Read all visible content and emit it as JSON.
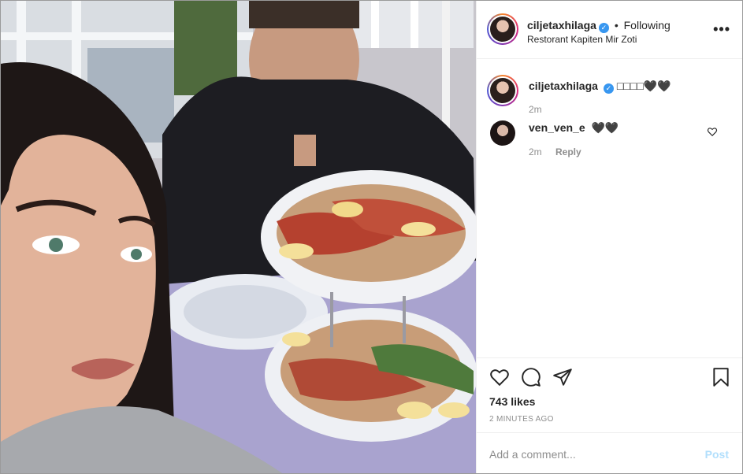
{
  "post": {
    "username": "ciljetaxhilaga",
    "verified_mark": "✓",
    "follow_separator": "•",
    "follow_status": "Following",
    "location": "Restorant Kapiten Mir Zoti",
    "more_label": "•••",
    "photo_icon": "post-photo"
  },
  "comments": [
    {
      "username": "ciljetaxhilaga",
      "text": "□□□□🖤🖤",
      "time": "2m"
    },
    {
      "username": "ven_ven_e",
      "text": "🖤🖤",
      "time": "2m",
      "reply_label": "Reply"
    }
  ],
  "actions": {
    "like_icon": "heart-icon",
    "comment_icon": "comment-icon",
    "share_icon": "share-icon",
    "save_icon": "bookmark-icon",
    "likes_text": "743 likes",
    "timestamp": "2 MINUTES AGO"
  },
  "add_comment": {
    "placeholder": "Add a comment...",
    "post_label": "Post"
  },
  "colors": {
    "verified": "#3897f0",
    "post_disabled": "#b2dffc",
    "muted": "#8e8e8e"
  }
}
